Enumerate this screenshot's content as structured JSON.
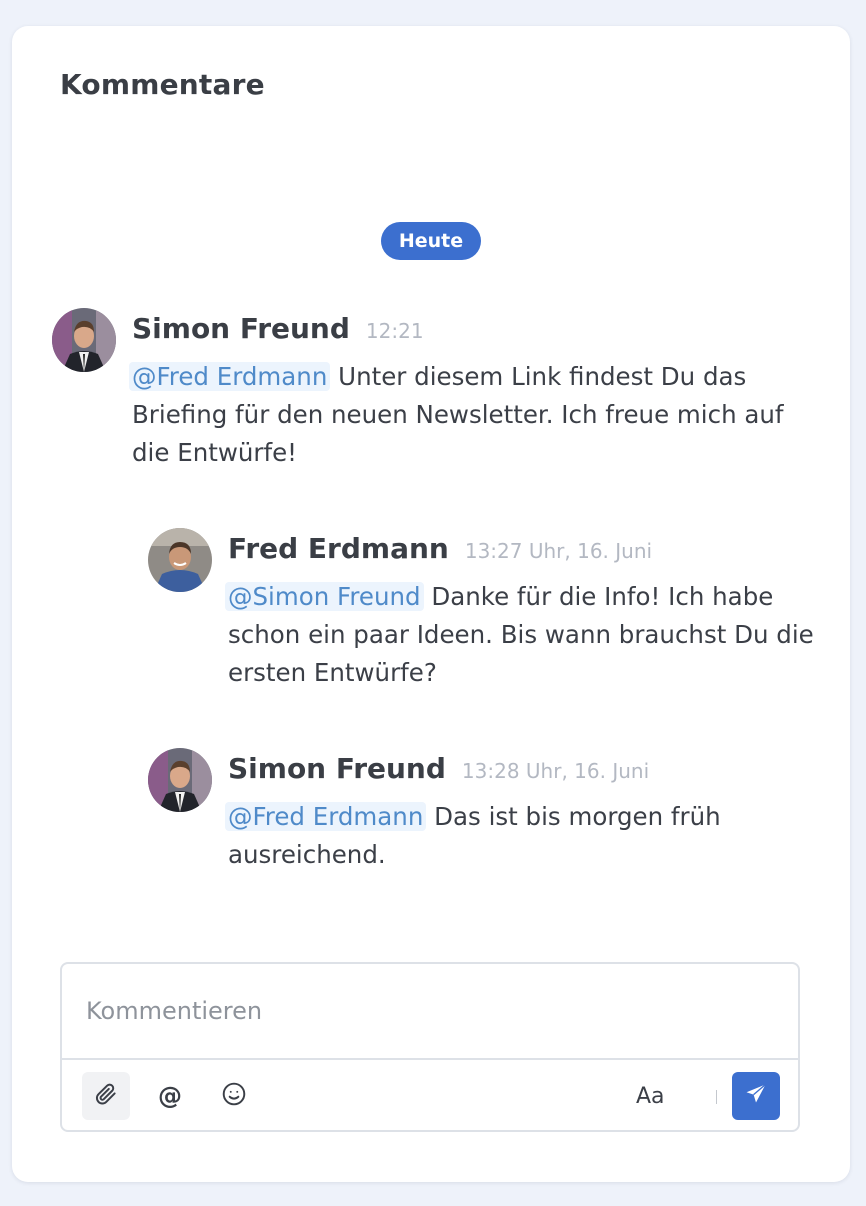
{
  "panel": {
    "title": "Kommentare"
  },
  "day_badge": "Heute",
  "comments": [
    {
      "author": "Simon Freund",
      "time": "12:21",
      "mention": "@Fred Erdmann",
      "text": " Unter diesem Link findest Du das Briefing für den neuen Newsletter. Ich freue mich auf die Entwürfe!",
      "avatar": "avatar-simon-freund"
    },
    {
      "author": "Fred Erdmann",
      "time": "13:27 Uhr, 16. Juni",
      "mention": "@Simon Freund",
      "text": " Danke für die Info! Ich habe schon ein paar Ideen. Bis wann brauchst Du die ersten Entwürfe?",
      "avatar": "avatar-fred-erdmann"
    },
    {
      "author": "Simon Freund",
      "time": "13:28 Uhr, 16. Juni",
      "mention": "@Fred Erdmann",
      "text": " Das ist bis morgen früh ausreichend.",
      "avatar": "avatar-simon-freund"
    }
  ],
  "composer": {
    "placeholder": "Kommentieren",
    "value": "",
    "mention_symbol": "@",
    "format_label": "Aa",
    "icons": [
      "paperclip-icon",
      "at-icon",
      "smiley-icon",
      "paper-plane-icon"
    ]
  },
  "colors": {
    "accent": "#3c6fcf",
    "mention_bg": "#ecf4fd",
    "mention_text": "#4f8ac9",
    "page_bg": "#eef2fa"
  }
}
